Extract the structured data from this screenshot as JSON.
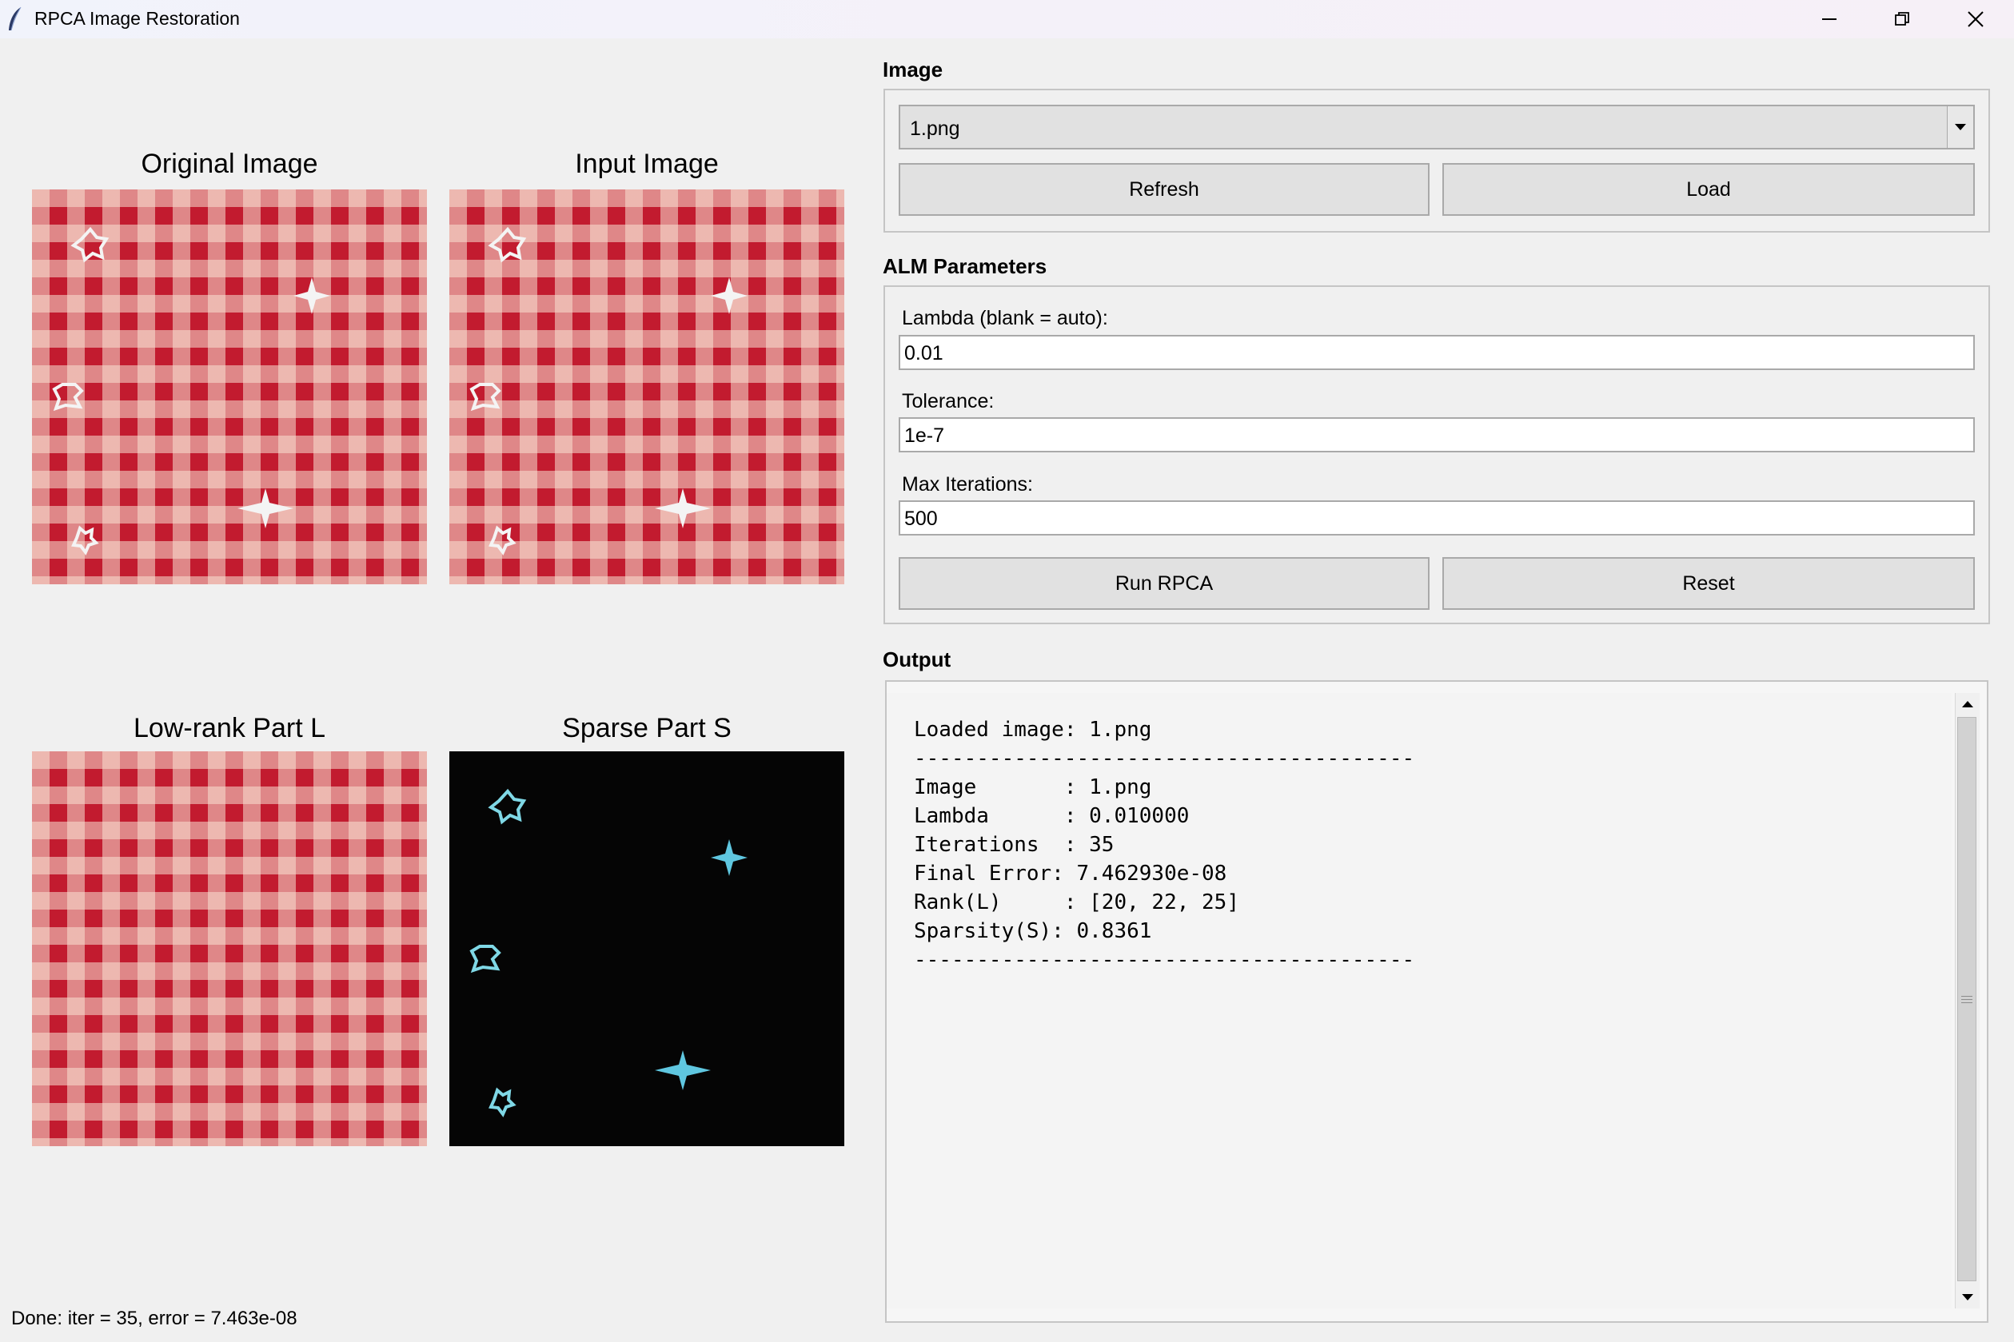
{
  "window": {
    "title": "RPCA Image Restoration",
    "icon": "feather-icon",
    "controls": [
      "minimize-icon",
      "restore-icon",
      "close-icon"
    ]
  },
  "panes": {
    "original": "Original Image",
    "input": "Input Image",
    "lowrank": "Low-rank Part L",
    "sparse": "Sparse Part S"
  },
  "image_section": {
    "label": "Image",
    "selected": "1.png",
    "refresh_label": "Refresh",
    "load_label": "Load"
  },
  "alm": {
    "label": "ALM Parameters",
    "lambda_label": "Lambda (blank = auto):",
    "lambda_value": "0.01",
    "tolerance_label": "Tolerance:",
    "tolerance_value": "1e-7",
    "maxiter_label": "Max Iterations:",
    "maxiter_value": "500",
    "run_label": "Run RPCA",
    "reset_label": "Reset"
  },
  "output": {
    "label": "Output",
    "text": "Loaded image: 1.png\n----------------------------------------\nImage       : 1.png\nLambda      : 0.010000\nIterations  : 35\nFinal Error: 7.462930e-08\nRank(L)     : [20, 22, 25]\nSparsity(S): 0.8361\n----------------------------------------"
  },
  "status": "Done: iter = 35, error = 7.463e-08",
  "colors": {
    "checker_red": "#c21b2f",
    "checker_light": "#f8e0d2",
    "sparse_background": "#050505",
    "sparse_marks": "#7fd8e6"
  }
}
